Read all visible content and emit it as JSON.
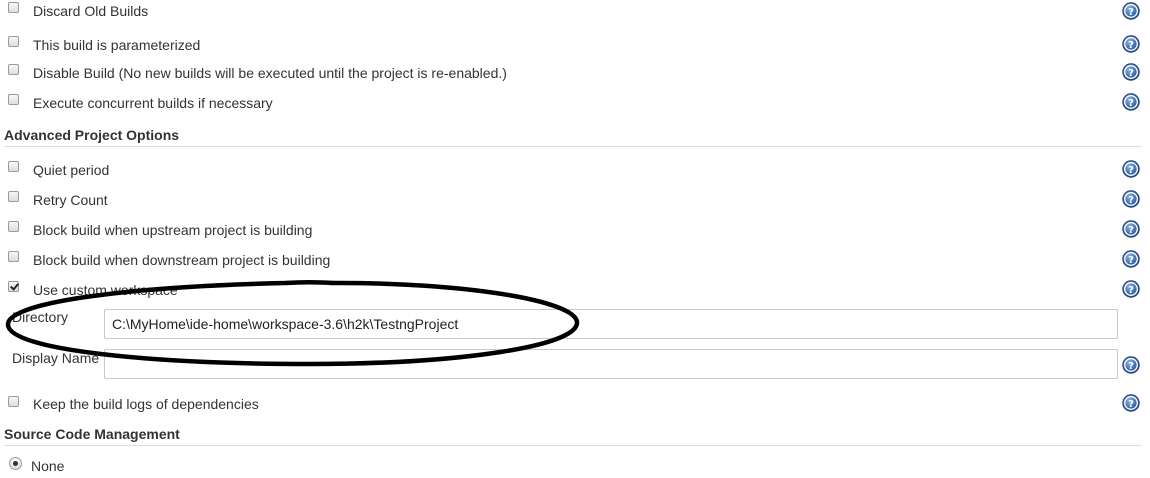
{
  "options_top": [
    {
      "label": "Discard Old Builds",
      "checked": false
    },
    {
      "label": "This build is parameterized",
      "checked": false
    },
    {
      "label": "Disable Build (No new builds will be executed until the project is re-enabled.)",
      "checked": false
    },
    {
      "label": "Execute concurrent builds if necessary",
      "checked": false
    }
  ],
  "advanced": {
    "heading": "Advanced Project Options",
    "options": [
      {
        "label": "Quiet period",
        "checked": false
      },
      {
        "label": "Retry Count",
        "checked": false
      },
      {
        "label": "Block build when upstream project is building",
        "checked": false
      },
      {
        "label": "Block build when downstream project is building",
        "checked": false
      },
      {
        "label": "Use custom workspace",
        "checked": true
      }
    ],
    "directory": {
      "label": "Directory",
      "value": "C:\\MyHome\\ide-home\\workspace-3.6\\h2k\\TestngProject"
    },
    "display_name": {
      "label": "Display Name",
      "value": ""
    },
    "keep_logs": {
      "label": "Keep the build logs of dependencies",
      "checked": false
    }
  },
  "scm": {
    "heading": "Source Code Management",
    "options": [
      {
        "label": "None",
        "selected": true
      }
    ]
  },
  "icons": {
    "help": "help-icon"
  },
  "colors": {
    "help_icon": "#3465a4",
    "annotation_ink": "#000000"
  }
}
